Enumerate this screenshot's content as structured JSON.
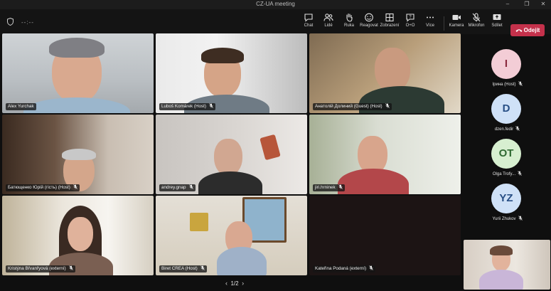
{
  "window": {
    "title": "CZ-UA meeting"
  },
  "toolbar": {
    "timer": "--:--",
    "buttons": [
      {
        "id": "chat",
        "label": "Chat",
        "icon": "chat-icon"
      },
      {
        "id": "people",
        "label": "Lidé",
        "icon": "people-icon"
      },
      {
        "id": "hand",
        "label": "Ruka",
        "icon": "raise-hand-icon"
      },
      {
        "id": "react",
        "label": "Reagovat",
        "icon": "smiley-icon"
      },
      {
        "id": "view",
        "label": "Zobrazení",
        "icon": "grid-view-icon"
      },
      {
        "id": "qa",
        "label": "O+O",
        "icon": "question-icon"
      },
      {
        "id": "more",
        "label": "Více",
        "icon": "more-icon"
      },
      {
        "id": "camera",
        "label": "Kamera",
        "icon": "camera-icon"
      },
      {
        "id": "mic",
        "label": "Mikrofon",
        "icon": "mic-off-icon"
      },
      {
        "id": "share",
        "label": "Sdílet",
        "icon": "share-icon"
      }
    ],
    "leave_label": "Odejít",
    "accent": "#c4314b"
  },
  "grid": {
    "active_outline": "#8f88e6",
    "tiles": [
      {
        "name": "Alex Yurchak",
        "muted": false
      },
      {
        "name": "Luboš Komárek (Host)",
        "muted": true
      },
      {
        "name": "Анатолій Долиний (Guest) (Host)",
        "muted": true
      },
      {
        "name": "Батющенко Юрій (гість) (Host)",
        "muted": true
      },
      {
        "name": "andrey.gnap",
        "muted": true
      },
      {
        "name": "jiri.hrninek",
        "muted": true,
        "active": true
      },
      {
        "name": "Kristýna Břvanřyová (externí)",
        "muted": true
      },
      {
        "name": "Biret CREA (Host)",
        "muted": true
      },
      {
        "name": "Kateřina Podaná (externí)",
        "muted": true
      }
    ]
  },
  "participants": [
    {
      "initials": "I",
      "name": "Ірина (Host)",
      "color": "#f3cdd6",
      "text_color": "#8a2b3f"
    },
    {
      "initials": "D",
      "name": "dzen.fedir",
      "color": "#cfe1f7",
      "text_color": "#284f85"
    },
    {
      "initials": "OT",
      "name": "Olga Trofy...",
      "color": "#d7efd0",
      "text_color": "#2f6a32"
    },
    {
      "initials": "YZ",
      "name": "Yurii Zhukov",
      "color": "#cfe1f7",
      "text_color": "#284f85"
    }
  ],
  "pager": {
    "label": "1/2",
    "prev_icon": "chevron-left-icon",
    "next_icon": "chevron-right-icon"
  }
}
